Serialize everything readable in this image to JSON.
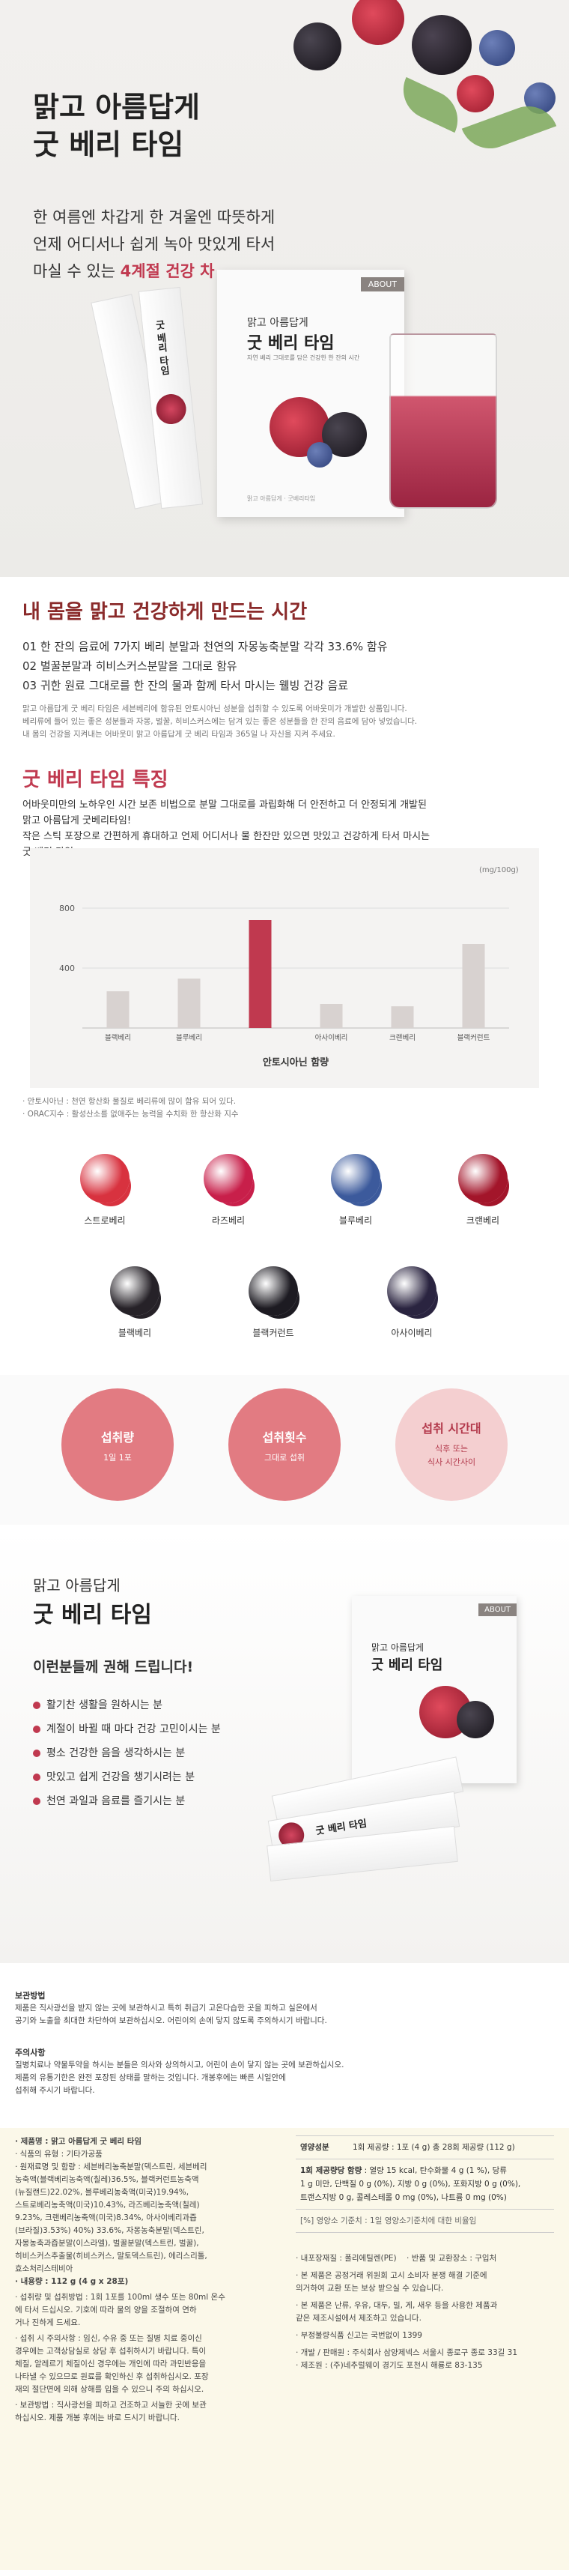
{
  "hero": {
    "title_line1": "맑고 아름답게",
    "title_line2": "굿 베리 타임",
    "sub_line1": "한 여름엔 차갑게 한 겨울엔 따뜻하게",
    "sub_line2": "언제 어디서나 쉽게 녹아 맛있게 타서",
    "sub_line3_prefix": "마실 수 있는 ",
    "sub_line3_bold": "4계절 건강 차",
    "box_brand": "ABOUT",
    "box_title_1": "맑고 아름답게",
    "box_title_2": "굿 베리 타임",
    "box_desc": "자연 베리 그대로를 담은 건강한 한 잔의 시간",
    "stick_label": "굿 베리 타임",
    "box_bottom": "맑고 아름답게 · 굿베리타임"
  },
  "section_time": {
    "heading": "내 몸을 맑고 건강하게 만드는 시간",
    "points": [
      "01 한 잔의 음료에 7가지 베리 분말과 천연의 자몽농축분말 각각 33.6% 함유",
      "02 벌꿀분말과 히비스커스분말을 그대로 함유",
      "03 귀한 원료 그대로를 한 잔의 물과 함께 타서 마시는 웰빙 건강 음료"
    ],
    "desc_1": "맑고 아름답게 굿 베리 타임은 세븐베리에 함유된 안토시아닌 성분을 섭취할 수 있도록 어바웃미가 개발한 상품입니다.",
    "desc_2": "베리류에 들어 있는 좋은 성분들과 자몽, 벌꿀, 히비스커스에는 담겨 있는 좋은 성분들을 한 잔의 음료에 담아 넣었습니다.",
    "desc_3": "내 몸의 건강을 지켜내는 어바웃미 맑고 아름답게 굿 베리 타임과 365일 나 자신을 지켜 주세요."
  },
  "section_feature": {
    "heading": "굿 베리 타임 특징",
    "desc_1": "어바웃미만의 노하우인 시간 보존 비법으로 분말 그대로를 과립화해 더 안전하고 더 안정되게 개발된",
    "desc_2": "맑고 아름답게 굿베리타임!",
    "desc_3": "작은 스틱 포장으로 간편하게 휴대하고 언제 어디서나 물 한잔만 있으면 맛있고 건강하게 타서 마시는",
    "desc_4": "굿 베리 타임"
  },
  "chart_data": {
    "type": "bar",
    "title": "안토시아닌 함량",
    "unit": "(mg/100g)",
    "categories": [
      "블랙베리",
      "블루베리",
      "",
      "아사이베리",
      "크랜베리",
      "블랙커런트"
    ],
    "values": [
      245,
      330,
      720,
      160,
      145,
      560
    ],
    "highlight_index": 2,
    "yticks": [
      400,
      800
    ],
    "ylim": [
      0,
      1000
    ],
    "colors": {
      "normal": "#d8d2d0",
      "highlight": "#c0394f",
      "grid": "#dddddd"
    }
  },
  "chart_notes": {
    "note_1": "· 안토시아닌 : 천연 항산화 물질로 베리류에 많이 함유 되어 있다.",
    "note_2": "· ORAC지수 : 활성산소를 없애주는 능력을 수치화 한 항산화 지수"
  },
  "berries": [
    {
      "label": "스트로베리",
      "icon": "strawberry-icon",
      "color": "#d8323f"
    },
    {
      "label": "라즈베리",
      "icon": "raspberry-icon",
      "color": "#c81f4a"
    },
    {
      "label": "블루베리",
      "icon": "blueberry-icon",
      "color": "#3c5a9c"
    },
    {
      "label": "크랜베리",
      "icon": "cranberry-icon",
      "color": "#a3152a"
    },
    {
      "label": "블랙베리",
      "icon": "blackberry-icon",
      "color": "#262228"
    },
    {
      "label": "블랙커런트",
      "icon": "blackcurrant-icon",
      "color": "#1d1b22"
    },
    {
      "label": "아사이베리",
      "icon": "acai-icon",
      "color": "#2a2440"
    }
  ],
  "intake": [
    {
      "title": "섭취량",
      "sub": "1일 1포",
      "color": "#e27b82"
    },
    {
      "title": "섭취횟수",
      "sub": "그대로 섭취",
      "color": "#e27b82"
    },
    {
      "title": "섭취 시간대",
      "sub_1": "식후 또는",
      "sub_2": "식사 시간사이",
      "color": "#f4cfd0"
    }
  ],
  "recommend": {
    "title_1": "맑고 아름답게",
    "title_2": "굿 베리 타임",
    "heading": "이런분들께 권해 드립니다!",
    "items": [
      "활기찬 생활을 원하시는 분",
      "계절이 바뀔 때 마다 건강 고민이시는 분",
      "평소 건강한 음을 생각하시는 분",
      "맛있고 쉽게 건강을 챙기시려는 분",
      "천연 과일과 음료를 즐기시는 분"
    ]
  },
  "storage": {
    "heading": "보관방법",
    "text_1": "제품은 직사광선을 받지 않는 곳에 보관하시고 특히 취급기 고온다습한 곳을 피하고 실온에서",
    "text_2": "공기와 노출을 최대한 차단하여 보관하십시오. 어린이의 손에 닿지 않도록 주의하시기 바랍니다."
  },
  "caution": {
    "heading": "주의사항",
    "text_1": "질병치료나 약물투약을 하시는 분들은 의사와 상의하시고, 어린이 손이 닿지 않는 곳에 보관하십시오.",
    "text_2": "제품의 유통기한은 완전 포장된 상태를 말하는 것입니다. 개봉후에는 빠른 시일안에",
    "text_3": "섭취해 주시기 바랍니다."
  },
  "label": {
    "product_name": "· 제품명 : 맑고 아름답게 굿 베리 타임",
    "food_type": "· 식품의 유형 : 기타가공품",
    "ingredients": [
      "· 원재료명 및 함량 : 세븐베리농축분말(덱스트린, 세븐베리",
      "농축액(블랙베리농축액(칠레)36.5%, 블랙커런트농축액",
      "(뉴질랜드)22.02%, 블루베리농축액(미국)19.94%,",
      "스트로베리농축액(미국)10.43%, 라즈베리농축액(칠레)",
      "9.23%, 크랜베리농축액(미국)8.34%, 아사이베리과즙",
      "(브라질)3.53%) 40%) 33.6%, 자몽농축분말(덱스트린,",
      "자몽농축과즙분말(이스라엘), 벌꿀분말(덱스트린, 벌꿀),",
      "히비스커스추출물(히비스커스, 말토덱스트린), 에리스리톨,",
      "효소처리스테비아"
    ],
    "weight": "· 내용량 : 112 g (4 g x 28포)",
    "how_to": [
      "· 섭취량 및 섭취방법 : 1회 1포를 100ml 생수 또는 80ml 온수",
      "  에 타서 드십시오. 기호에 따라 물의 양을 조절하여 연하",
      "  거나 진하게 드세요."
    ],
    "caution": [
      "· 섭취 시 주의사항 : 임신, 수유 중 또는 질병 치료 중이신",
      "  경우에는 고객상담실로 상담 후 섭취하시기 바랍니다. 특이",
      "  체질, 알레르기 체질이신 경우에는 개인에 따라 과민반응을",
      "  나타낼 수 있으므로 원료를 확인하신 후 섭취하십시오. 포장",
      "  재의 절단면에 의해 상해를 입을 수 있으니 주의 하십시오."
    ],
    "storage": [
      "· 보관방법 : 직사광선을 피하고 건조하고 서늘한 곳에 보관",
      "  하십시오. 제품 개봉 후에는 바로 드시기 바랍니다."
    ]
  },
  "nutrition": {
    "header": "영양성분",
    "serving": "1회 제공량 : 1포 (4 g)   총 28회 제공량 (112 g)",
    "row_label": "1회 제공량당 함량",
    "row_values_1": ": 열량 15 kcal, 탄수화물 4 g (1 %), 당류",
    "row_values_2": "1 g 미만, 단백질 0 g (0%), 지방 0 g (0%), 포화지방 0 g (0%),",
    "row_values_3": "트랜스지방 0 g, 콜레스테롤 0 mg (0%), 나트륨 0 mg (0%)",
    "note": "[%] 영양소 기준치 : 1일 영양소기준치에 대한 비율임"
  },
  "extra": {
    "manufacturer": "· 내포장재질 : 폴리에틸렌(PE)",
    "return": "· 반품 및 교환장소 : 구입처",
    "law_1": "· 본 제품은 공정거래 위원회 고시 소비자 분쟁 해결 기준에",
    "law_2": "  의거하여 교환 또는 보상 받으실 수 있습니다.",
    "allergy_1": "· 본 제품은 난류, 우유, 대두, 밀, 게, 새우 등을 사용한 제품과",
    "allergy_2": "  같은 제조시설에서 제조하고 있습니다.",
    "report": "· 부정불량식품 신고는 국번없이 1399",
    "seller": "· 개발 / 판매원 : 주식회사 삼양제넥스 서울시 종로구 종로 33길 31",
    "maker": "· 제조원 : (주)네추럴웨이 경기도 포천시 해룡로 83-135"
  }
}
